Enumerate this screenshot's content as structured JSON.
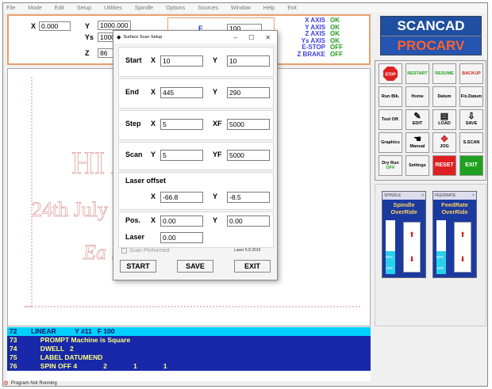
{
  "menu": [
    "File",
    "Mode",
    "Edit",
    "Setup",
    "Utilities",
    "Spindle",
    "Options",
    "Sources",
    "Window",
    "Help",
    "Exit"
  ],
  "coords": {
    "x_label": "X",
    "x_value": "0.000",
    "y_label": "Y",
    "y_value": "1000.000",
    "ys_label": "Ys",
    "ys_value": "1000",
    "z_label": "Z",
    "z_value": "86",
    "f_label": "F",
    "f_value": "100"
  },
  "axis_status": [
    {
      "name": "X AXIS",
      "value": "OK"
    },
    {
      "name": "Y AXIS",
      "value": "OK"
    },
    {
      "name": "Z AXIS",
      "value": "OK"
    },
    {
      "name": "Ys AXIS",
      "value": "OK"
    },
    {
      "name": "E-STOP",
      "value": "OFF"
    },
    {
      "name": "Z BRAKE",
      "value": "OFF"
    }
  ],
  "brand": {
    "line1": "SCANCAD",
    "line2": "PROCARV"
  },
  "buttons": {
    "stop": "STOP",
    "restart": "RESTART",
    "resume": "RESUME",
    "backup": "BACKUP",
    "run_blk": "Run Blk.",
    "home": "Home",
    "datum": "Datum",
    "fix_datum": "Fix.Datum",
    "tool_off": "Tool Off.",
    "edit": "EDIT",
    "load": "LOAD",
    "save": "SAVE",
    "graphics": "Graphics",
    "manual": "Manual",
    "jog": "JOG",
    "s_scan": "S.SCAN",
    "dry_run": "Dry Run",
    "dry_run_state": "OFF",
    "settings": "Settings",
    "reset": "RESET",
    "exit": "EXIT"
  },
  "spindle": {
    "title_bar": "SPINDLE",
    "title": "Spindle OverRide",
    "levels": [
      "200%",
      "150%",
      "100%",
      "50%",
      "10%"
    ],
    "fill_fraction": 0.42
  },
  "feedrate": {
    "title_bar": "FEEDRATE",
    "title": "FeedRate OverRide",
    "levels": [
      "200%",
      "150%",
      "100%",
      "50%",
      "10%"
    ],
    "fill_fraction": 0.42
  },
  "canvas_text": {
    "line1": "HI ART",
    "line2": "24th July ust 2017",
    "line3": "Ea ng"
  },
  "program": [
    {
      "n": "72",
      "text": "LINEAR          Y #11   F 100",
      "highlight": true
    },
    {
      "n": "73",
      "text": "     PROMPT Machine is Square",
      "highlight": false
    },
    {
      "n": "74",
      "text": "     DWELL   2",
      "highlight": false
    },
    {
      "n": "75",
      "text": "     LABEL DATUMEND",
      "highlight": false
    },
    {
      "n": "76",
      "text": "     SPIN OFF 4              2              1              1",
      "highlight": false
    }
  ],
  "status_text": "Program Not Running",
  "dialog": {
    "title": "Surface Scan Setup",
    "start_label": "Start",
    "start_x_label": "X",
    "start_x": "10",
    "start_y_label": "Y",
    "start_y": "10",
    "end_label": "End",
    "end_x_label": "X",
    "end_x": "445",
    "end_y_label": "Y",
    "end_y": "290",
    "step_label": "Step",
    "step_x_label": "X",
    "step_x": "5",
    "xf_label": "XF",
    "xf": "5000",
    "scan_label": "Scan",
    "scan_y_label": "Y",
    "scan_y": "5",
    "yf_label": "YF",
    "yf": "5000",
    "laser_offset_label": "Laser offset",
    "lo_x_label": "X",
    "lo_x": "-66.8",
    "lo_y_label": "Y",
    "lo_y": "-8.5",
    "pos_label": "Pos.",
    "pos_x_label": "X",
    "pos_x": "0.00",
    "pos_y_label": "Y",
    "pos_y": "0.00",
    "laser_label": "Laser",
    "laser": "0.00",
    "scan_performed_label": "Scan Performed",
    "version": "Laser 5.8 2015",
    "start_button": "START",
    "save_button": "SAVE",
    "exit_button": "EXIT"
  }
}
